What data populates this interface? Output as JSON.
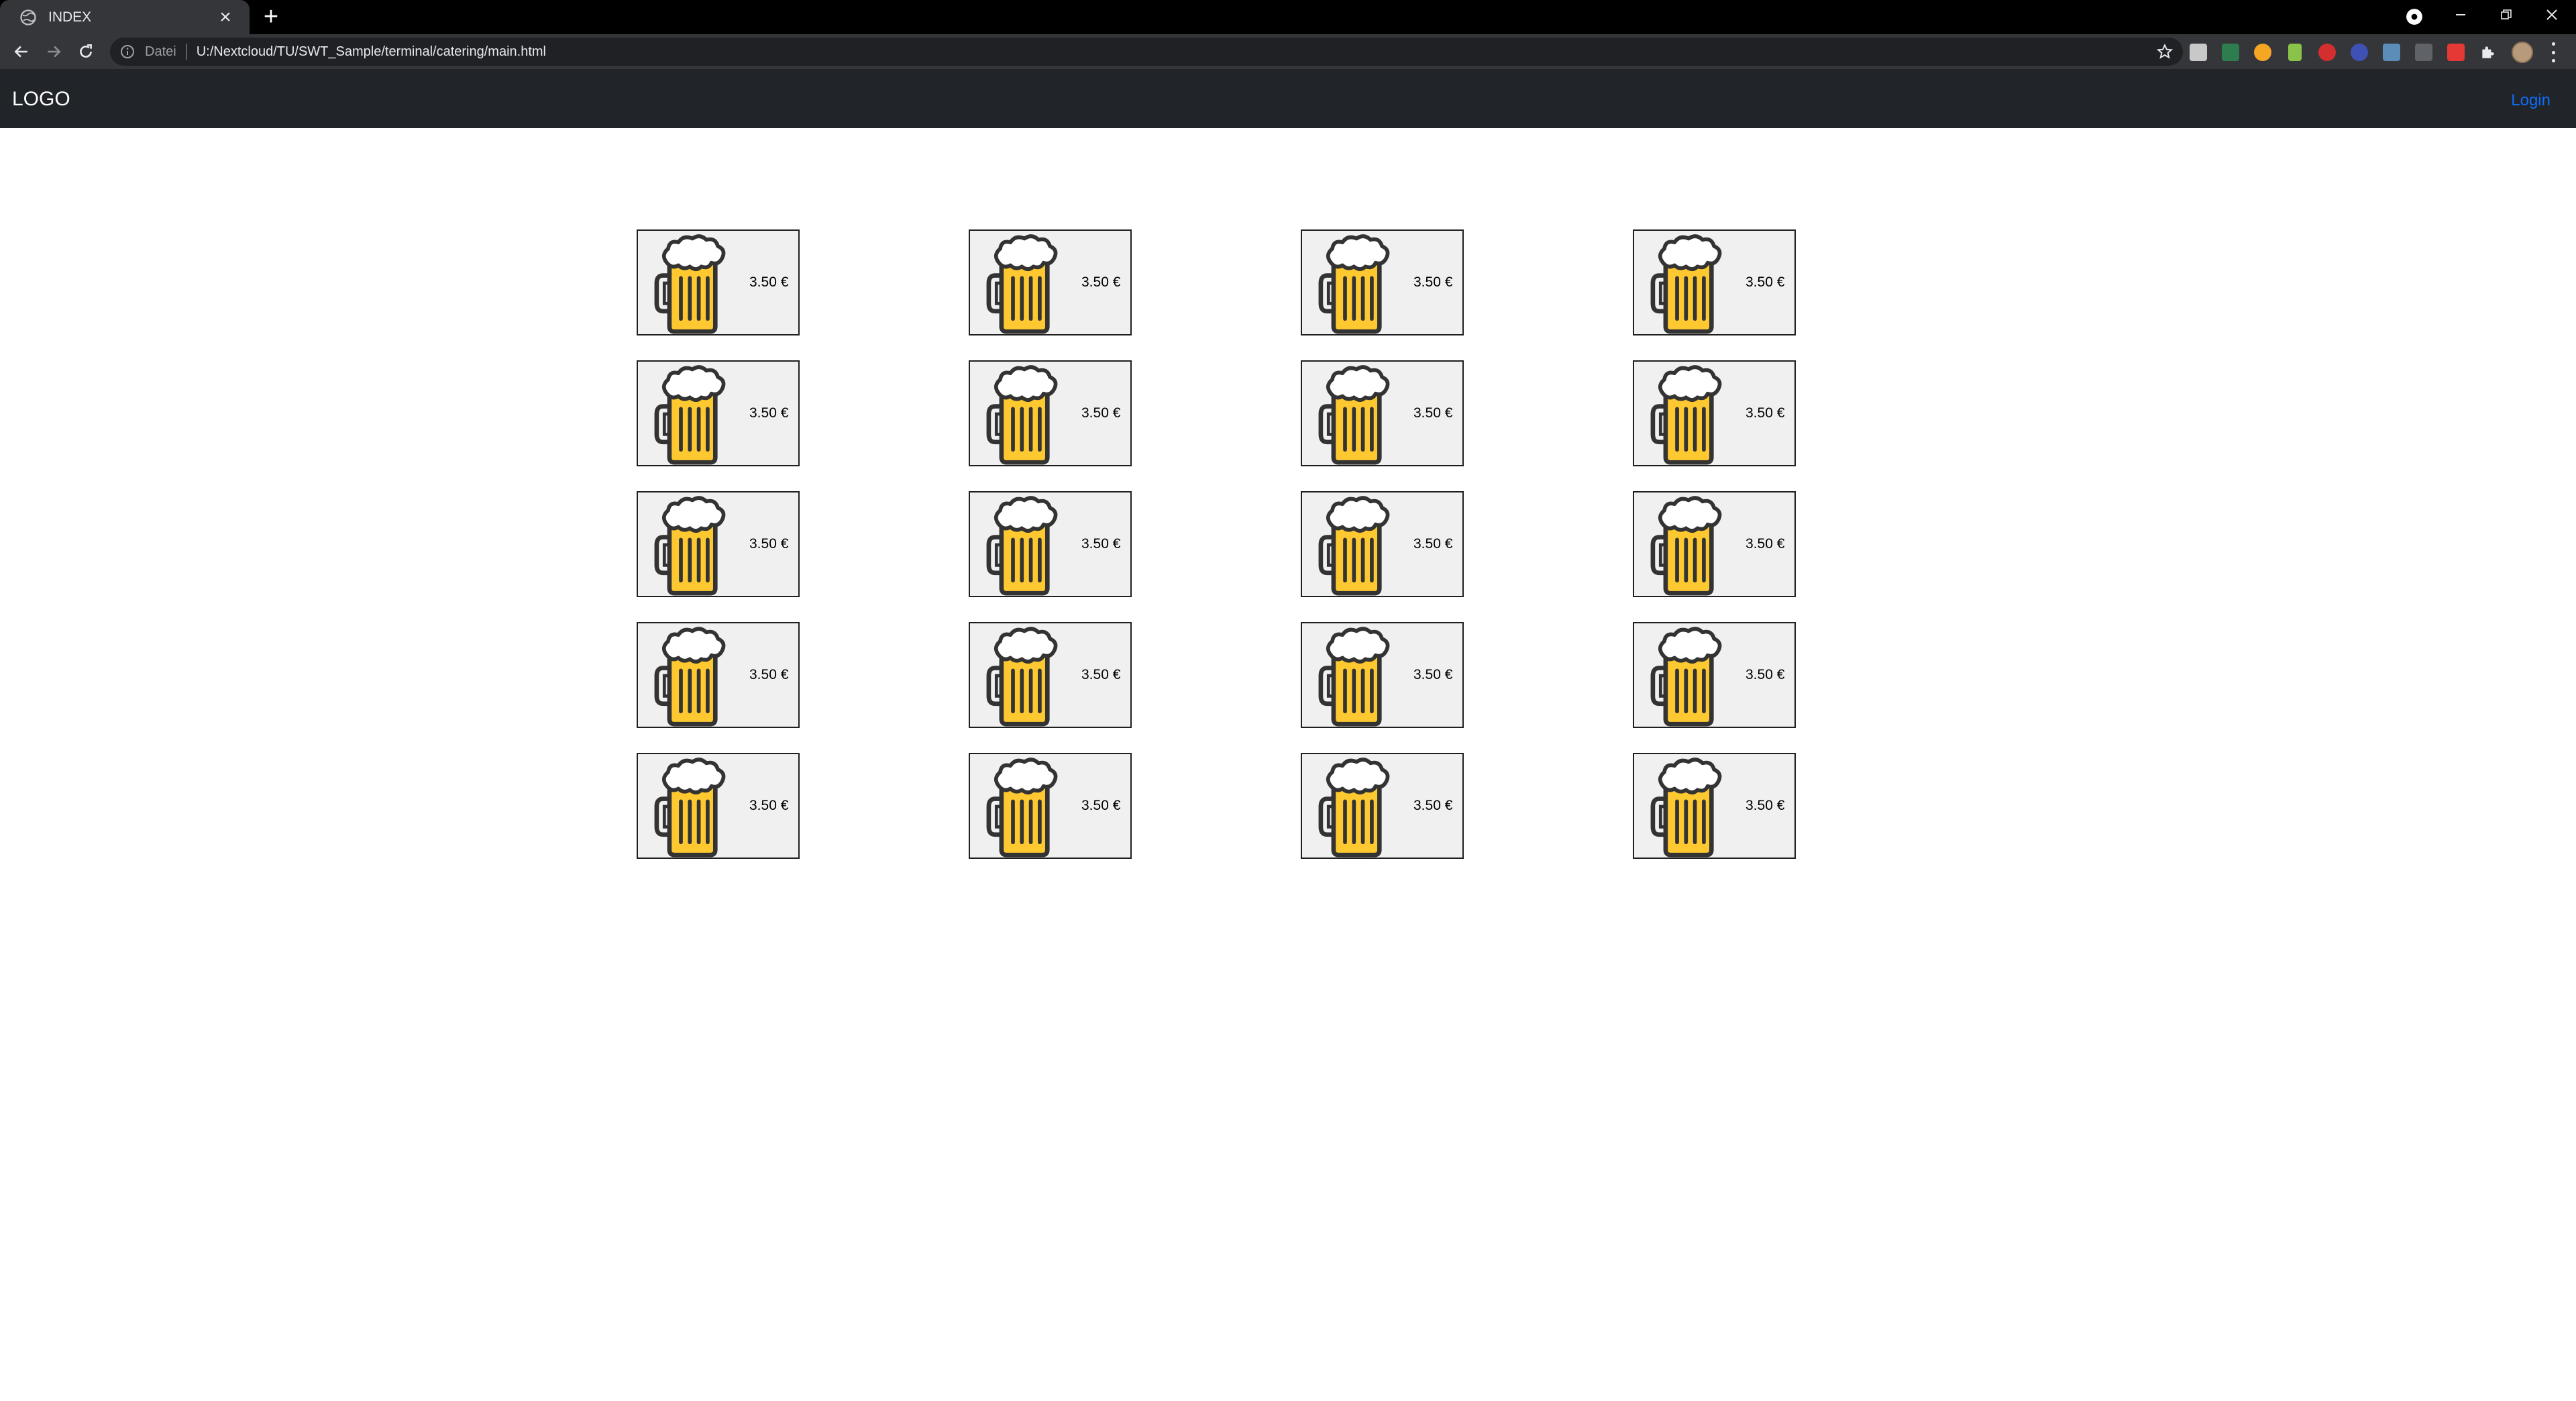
{
  "browser": {
    "tab": {
      "title": "INDEX",
      "favicon": "globe-icon"
    },
    "omnibox": {
      "scheme_label": "Datei",
      "url": "U:/Nextcloud/TU/SWT_Sample/terminal/catering/main.html"
    },
    "colors": {
      "frame": "#000000",
      "toolbar": "#35363a",
      "omnibox": "#202124"
    }
  },
  "page": {
    "navbar": {
      "logo": "LOGO",
      "login": "Login"
    },
    "colors": {
      "navbar_bg": "#212529",
      "link": "#0d6efd",
      "beer": "#fdc830"
    },
    "products": [
      {
        "price": "3.50 €"
      },
      {
        "price": "3.50 €"
      },
      {
        "price": "3.50 €"
      },
      {
        "price": "3.50 €"
      },
      {
        "price": "3.50 €"
      },
      {
        "price": "3.50 €"
      },
      {
        "price": "3.50 €"
      },
      {
        "price": "3.50 €"
      },
      {
        "price": "3.50 €"
      },
      {
        "price": "3.50 €"
      },
      {
        "price": "3.50 €"
      },
      {
        "price": "3.50 €"
      },
      {
        "price": "3.50 €"
      },
      {
        "price": "3.50 €"
      },
      {
        "price": "3.50 €"
      },
      {
        "price": "3.50 €"
      },
      {
        "price": "3.50 €"
      },
      {
        "price": "3.50 €"
      },
      {
        "price": "3.50 €"
      },
      {
        "price": "3.50 €"
      }
    ]
  }
}
